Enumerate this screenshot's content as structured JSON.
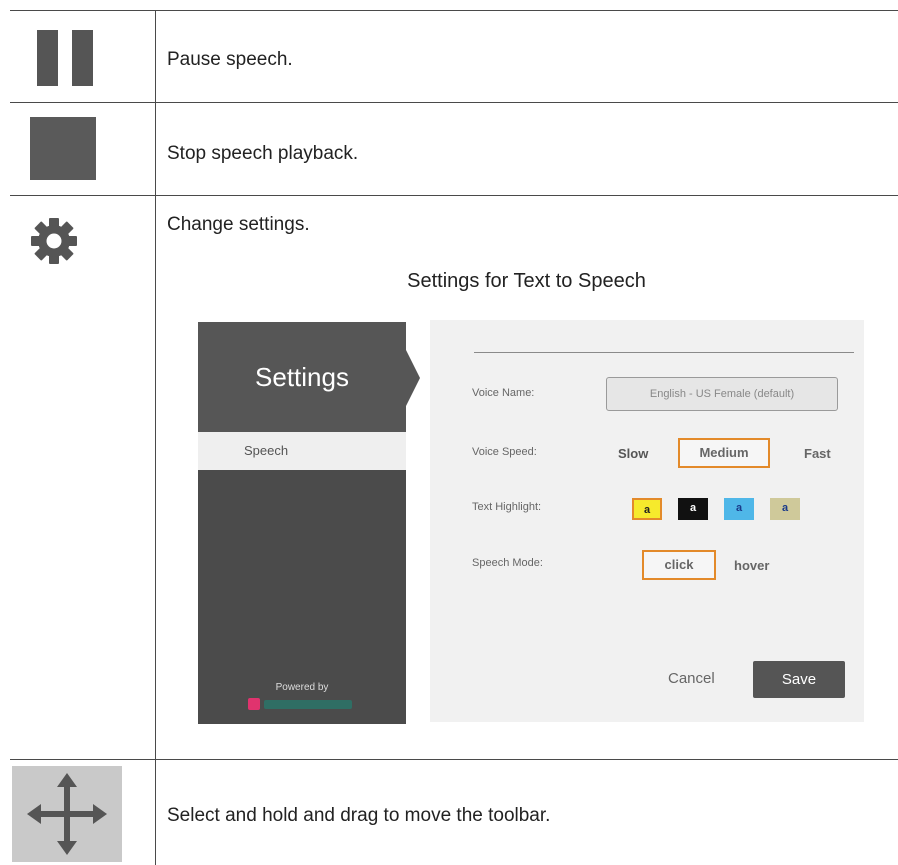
{
  "rows": [
    {
      "icon": "pause-icon",
      "description": "Pause speech."
    },
    {
      "icon": "stop-icon",
      "description": "Stop speech playback."
    },
    {
      "icon": "gear-icon",
      "description": "Change settings."
    },
    {
      "icon": "move-arrows-icon",
      "description": "Select and hold and drag to move the toolbar."
    }
  ],
  "settings_figure": {
    "title": "Settings for Text to Speech",
    "sidebar": {
      "header": "Settings",
      "tab": "Speech",
      "powered_by": "Powered by"
    },
    "form": {
      "voice_name_label": "Voice Name:",
      "voice_name_value": "English - US Female (default)",
      "voice_speed_label": "Voice Speed:",
      "voice_speed_options": [
        "Slow",
        "Medium",
        "Fast"
      ],
      "voice_speed_selected": "Medium",
      "text_highlight_label": "Text Highlight:",
      "text_highlight_options": [
        {
          "label": "a",
          "bg": "#f6ea2c",
          "fg": "#222222",
          "selected": true
        },
        {
          "label": "a",
          "bg": "#111111",
          "fg": "#ffffff",
          "selected": false
        },
        {
          "label": "a",
          "bg": "#4fb7e8",
          "fg": "#1a3a8a",
          "selected": false
        },
        {
          "label": "a",
          "bg": "#cfc99a",
          "fg": "#1a3a8a",
          "selected": false
        }
      ],
      "speech_mode_label": "Speech Mode:",
      "speech_mode_options": [
        "click",
        "hover"
      ],
      "speech_mode_selected": "click",
      "cancel_label": "Cancel",
      "save_label": "Save"
    },
    "colors": {
      "accent_border": "#e38a2a",
      "panel_dark": "#565656"
    }
  }
}
